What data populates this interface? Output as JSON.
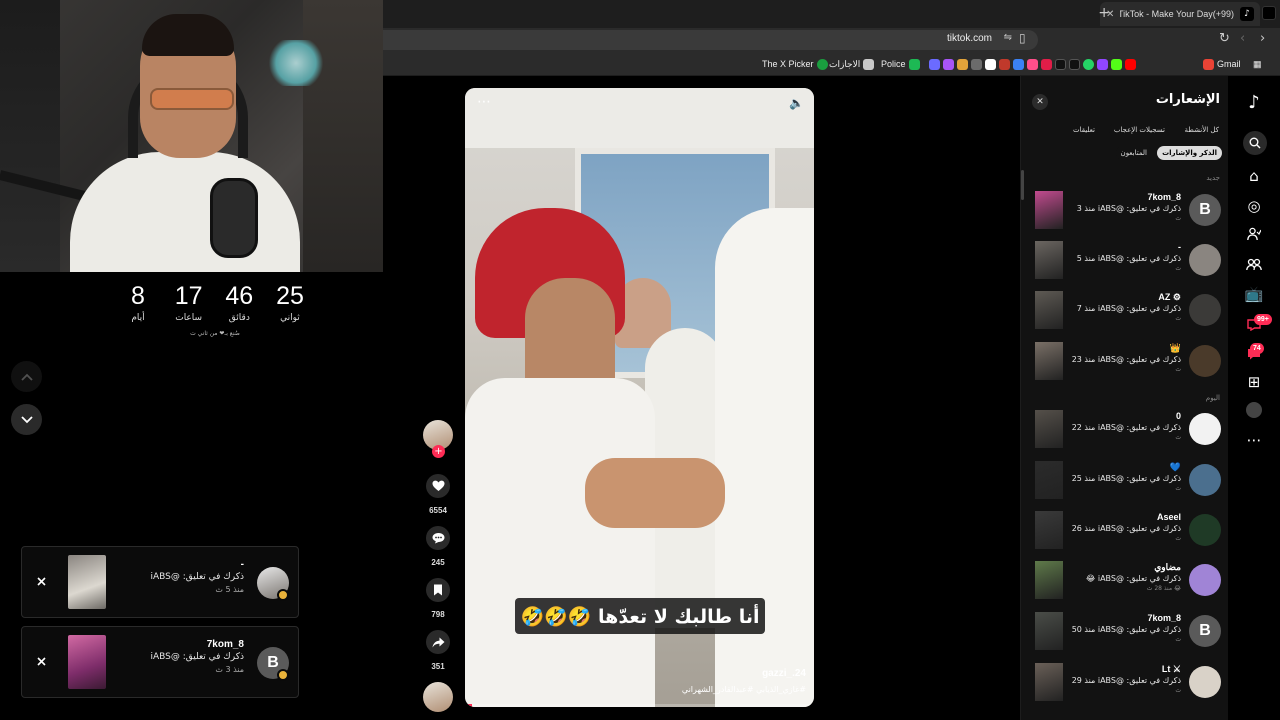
{
  "stream": {
    "countdown": [
      {
        "value": "8",
        "label": "أيام"
      },
      {
        "value": "17",
        "label": "ساعات"
      },
      {
        "value": "46",
        "label": "دقائق"
      },
      {
        "value": "25",
        "label": "ثواني"
      }
    ],
    "credit": "صُنع بـ❤ من ثاني ت",
    "toasts": [
      {
        "name": "-",
        "line": "ذكرك في تعليق: @iABS",
        "time": "منذ 5 ث"
      },
      {
        "name": "7kom_8",
        "line": "ذكرك في تعليق: @iABS",
        "time": "منذ 3 ث",
        "avatar_letter": "B"
      }
    ]
  },
  "browser": {
    "tab_title": "(99+)TikTok - Make Your Day",
    "url": "tiktok.com",
    "bookmarks": [
      {
        "label": "Gmail",
        "color": "#ea4335"
      },
      {
        "label": "Police",
        "color": "#1db954"
      },
      {
        "label": "الاجازات",
        "color": "#c9c9c9"
      },
      {
        "label": "The X Picker",
        "color": "#1a9e3f"
      }
    ]
  },
  "video": {
    "caption": "أنا طالبك لا تعدّها 🤣🤣🤣",
    "username": "gazzi_.24",
    "hashtags": "#غازي_الذيابي #عبدالقادر_الشهراني",
    "progress": 0.02,
    "actions": {
      "likes": "6554",
      "comments": "245",
      "saves": "798",
      "shares": "351"
    }
  },
  "notifications": {
    "title": "الإشعارات",
    "tabs": [
      "كل الأنشطة",
      "تسجيلات الإعجاب",
      "تعليقات"
    ],
    "tabs2": [
      "الذكر والإشارات",
      "المتابعون"
    ],
    "section_new": "جديد",
    "section_today": "اليوم",
    "items": [
      {
        "name": "7kom_8",
        "line": "ذكرك في تعليق: @iABS منذ 3",
        "sub": "ث",
        "avatar_letter": "B",
        "avatar_color": "#5a5a5a",
        "thumb_color": "#c24b8f"
      },
      {
        "name": "-",
        "line": "ذكرك في تعليق: @iABS منذ 5",
        "sub": "ث",
        "avatar_letter": "",
        "avatar_color": "#8a8580",
        "thumb_color": "#6b6661"
      },
      {
        "name": "AZ ⚙",
        "line": "ذكرك في تعليق: @iABS منذ 7",
        "sub": "ث",
        "avatar_letter": "",
        "avatar_color": "#3b3a38",
        "thumb_color": "#5e5a54"
      },
      {
        "name": "👑",
        "line": "ذكرك في تعليق: @iABS منذ 23",
        "sub": "ث",
        "avatar_letter": "",
        "avatar_color": "#4a3a2a",
        "thumb_color": "#7a7067"
      },
      {
        "name": "0",
        "line": "ذكرك في تعليق: @iABS منذ 22",
        "sub": "ث",
        "avatar_letter": "",
        "avatar_color": "#f2f2f2",
        "thumb_color": "#55504a"
      },
      {
        "name": "💙",
        "line": "ذكرك في تعليق: @iABS منذ 25",
        "sub": "ث",
        "avatar_letter": "",
        "avatar_color": "#4b6f8e",
        "thumb_color": "#2b2b2b"
      },
      {
        "name": "Aseel",
        "line": "ذكرك في تعليق: @iABS منذ 26",
        "sub": "ث",
        "avatar_letter": "",
        "avatar_color": "#1f3a26",
        "thumb_color": "#3a3a3a"
      },
      {
        "name": "مضاوي",
        "line": "ذكرك في تعليق: @iABS 😂",
        "sub": "😂 منذ 28 ث",
        "avatar_letter": "",
        "avatar_color": "#a084d6",
        "thumb_color": "#5f7a4a"
      },
      {
        "name": "7kom_8",
        "line": "ذكرك في تعليق: @iABS منذ 50",
        "sub": "ث",
        "avatar_letter": "B",
        "avatar_color": "#5a5a5a",
        "thumb_color": "#4a4d48"
      },
      {
        "name": "Lt ⚔",
        "line": "ذكرك في تعليق: @iABS منذ 29",
        "sub": "ث",
        "avatar_letter": "",
        "avatar_color": "#d9d2c8",
        "thumb_color": "#6a6058"
      }
    ]
  },
  "rail": {
    "badge_inbox": "99+",
    "badge_messages": "74"
  }
}
